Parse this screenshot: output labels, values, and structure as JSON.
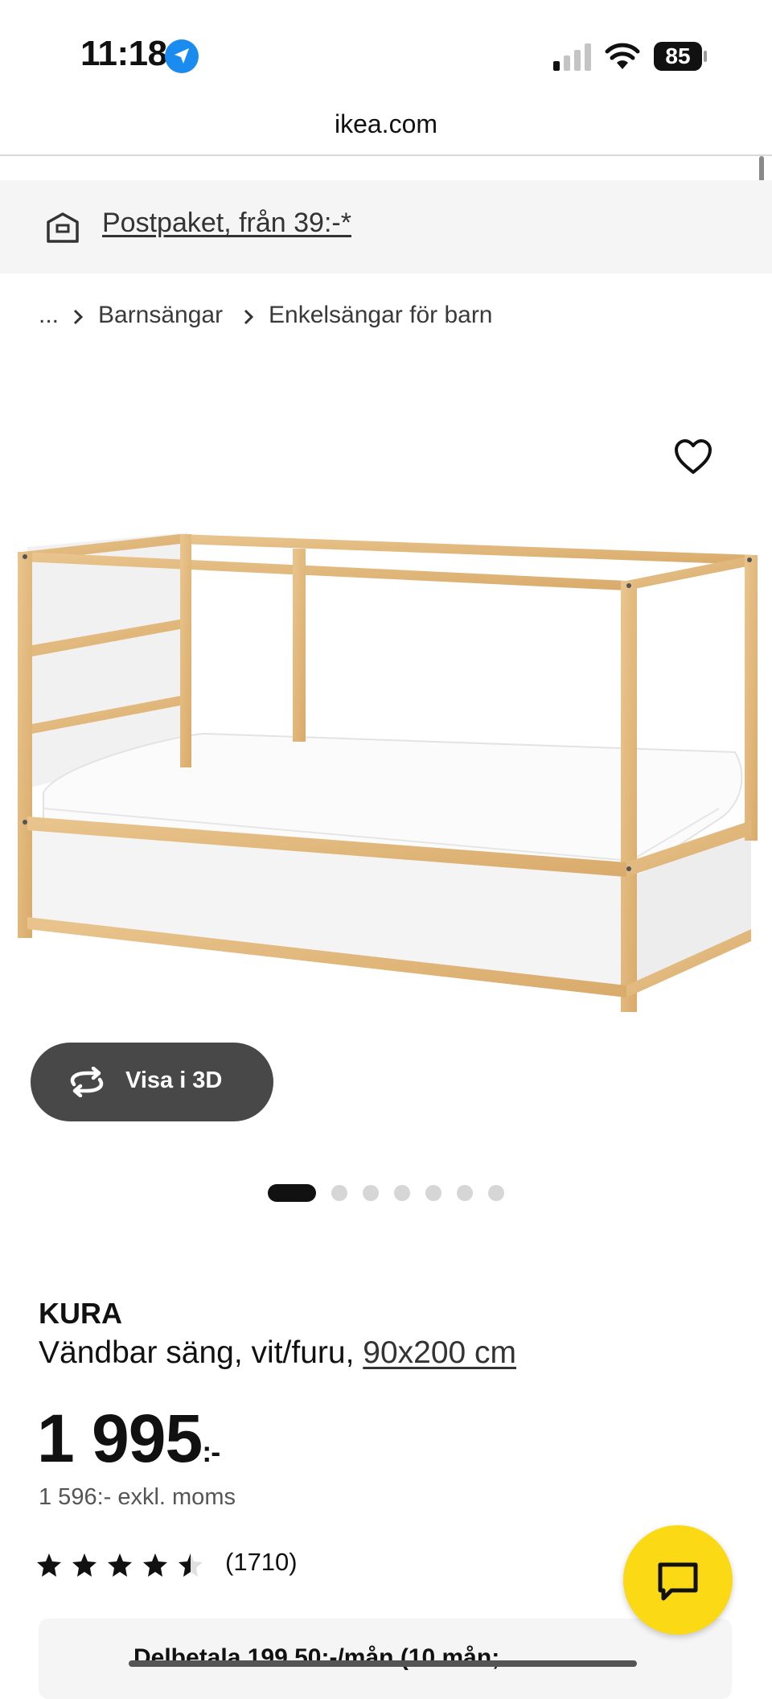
{
  "status_bar": {
    "time": "11:18",
    "battery": "85",
    "icons": [
      "location-arrow-icon",
      "cellular-signal-icon",
      "wifi-icon",
      "battery-icon"
    ]
  },
  "browser": {
    "url": "ikea.com"
  },
  "banner": {
    "icon": "parcel-icon",
    "link_text": "Postpaket, från 39:-*"
  },
  "breadcrumb": {
    "more": "...",
    "items": [
      "Barnsängar",
      "Enkelsängar för barn"
    ]
  },
  "media": {
    "favorite_icon": "heart-icon",
    "view_3d_label": "Visa i 3D",
    "view_3d_icon": "rotate-icon",
    "carousel": {
      "total": 7,
      "active": 1
    }
  },
  "product": {
    "name": "KURA",
    "description": "Vändbar säng, vit/furu, ",
    "size_link": "90x200 cm",
    "price": "1 995",
    "price_suffix": ":-",
    "price_excl_vat": "1 596:- exkl. moms",
    "rating": 4.6,
    "review_count": "(1710)"
  },
  "financing": {
    "text": "Delbetala 199.50:-/mån (10 mån;"
  },
  "chat": {
    "icon": "chat-icon"
  },
  "colors": {
    "ikea_yellow": "#fbd914",
    "button_dark": "#484848",
    "banner_bg": "#f5f5f5"
  }
}
